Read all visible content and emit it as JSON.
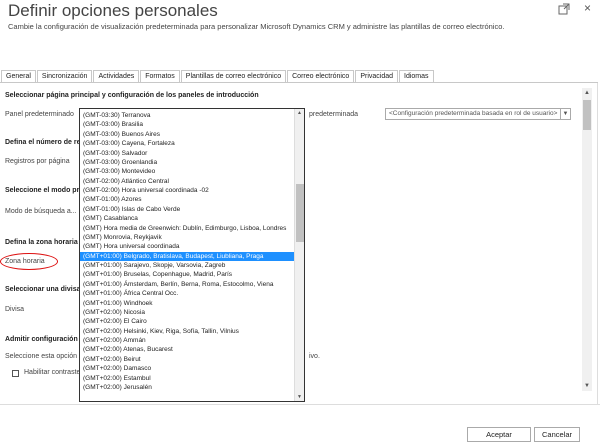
{
  "dialog": {
    "title": "Definir opciones personales",
    "subtitle": "Cambie la configuración de visualización predeterminada para personalizar Microsoft Dynamics CRM y administre las plantillas de correo electrónico.",
    "close_glyph": "×"
  },
  "tabs": [
    {
      "label": "General"
    },
    {
      "label": "Sincronización"
    },
    {
      "label": "Actividades"
    },
    {
      "label": "Formatos"
    },
    {
      "label": "Plantillas de correo electrónico"
    },
    {
      "label": "Correo electrónico"
    },
    {
      "label": "Privacidad"
    },
    {
      "label": "Idiomas"
    }
  ],
  "form": {
    "section1_heading": "Seleccionar página principal y configuración de los paneles de introducción",
    "panel_label": "Panel predeterminado",
    "right_label": "predeterminada",
    "right_select_value": "<Configuración predeterminada basada en rol de usuario>",
    "section2_heading": "Defina el número de re",
    "records_label": "Registros por página",
    "section3_heading": "Seleccione el modo pred",
    "search_mode_label": "Modo de búsqueda a...",
    "section4_heading": "Defina la zona horaria",
    "timezone_label": "Zona horaria",
    "section5_heading": "Seleccionar una divisa p",
    "currency_label": "Divisa",
    "section6_heading": "Admitir configuración d",
    "section6_text": "Seleccione esta opción si",
    "section6_tail": "ivo.",
    "high_contrast_label": "Habilitar contraste"
  },
  "timezones": [
    "(GMT-03:30) Terranova",
    "(GMT-03:00) Brasilia",
    "(GMT-03:00) Buenos Aires",
    "(GMT-03:00) Cayena, Fortaleza",
    "(GMT-03:00) Salvador",
    "(GMT-03:00) Groenlandia",
    "(GMT-03:00) Montevideo",
    "(GMT-02:00) Atlántico Central",
    "(GMT-02:00) Hora universal coordinada -02",
    "(GMT-01:00) Azores",
    "(GMT-01:00) Islas de Cabo Verde",
    "(GMT) Casablanca",
    "(GMT) Hora media de Greenwich: Dublín, Edimburgo, Lisboa, Londres",
    "(GMT) Monrovia, Reykjavik",
    "(GMT) Hora universal coordinada",
    "(GMT+01:00) Belgrado, Bratislava, Budapest, Liubliana, Praga",
    "(GMT+01:00) Sarajevo, Skopje, Varsovia, Zagreb",
    "(GMT+01:00) Bruselas, Copenhague, Madrid, París",
    "(GMT+01:00) Ámsterdam, Berlín, Berna, Roma, Estocolmo, Viena",
    "(GMT+01:00) África Central Occ.",
    "(GMT+01:00) Windhoek",
    "(GMT+02:00) Nicosia",
    "(GMT+02:00) El Cairo",
    "(GMT+02:00) Helsinki, Kiev, Riga, Sofía, Tallin, Vilnius",
    "(GMT+02:00) Ammán",
    "(GMT+02:00) Atenas, Bucarest",
    "(GMT+02:00) Beirut",
    "(GMT+02:00) Damasco",
    "(GMT+02:00) Estambul",
    "(GMT+02:00) Jerusalén"
  ],
  "selected_timezone_index": 15,
  "buttons": {
    "accept": "Aceptar",
    "cancel": "Cancelar"
  },
  "colors": {
    "selection": "#1e90ff",
    "highlight_circle": "#dd1111"
  }
}
